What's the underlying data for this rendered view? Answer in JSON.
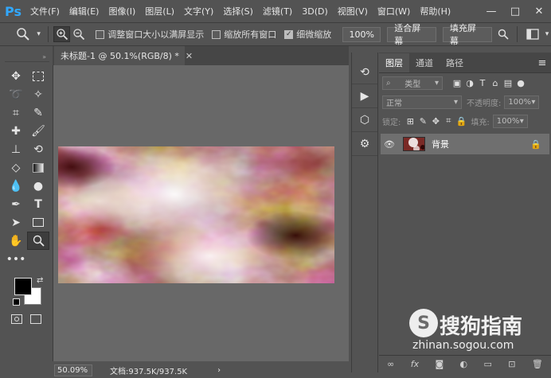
{
  "app": {
    "logo": "Ps"
  },
  "menu": [
    "文件(F)",
    "编辑(E)",
    "图像(I)",
    "图层(L)",
    "文字(Y)",
    "选择(S)",
    "滤镜(T)",
    "3D(D)",
    "视图(V)",
    "窗口(W)",
    "帮助(H)"
  ],
  "window_controls": {
    "minimize": "—",
    "maximize": "□",
    "close": "✕"
  },
  "options": {
    "resize_windows": "调整窗口大小以满屏显示",
    "zoom_all": "缩放所有窗口",
    "scrubby_zoom": "细微缩放",
    "zoom_100": "100%",
    "fit_screen": "适合屏幕",
    "fill_screen": "填充屏幕"
  },
  "document": {
    "tab_title": "未标题-1 @ 50.1%(RGB/8) *"
  },
  "status": {
    "zoom": "50.09%",
    "doc_info": "文档:937.5K/937.5K",
    "arrow": "›"
  },
  "layers_panel": {
    "tabs": [
      "图层",
      "通道",
      "路径"
    ],
    "filter_kind": "类型",
    "blend_mode": "正常",
    "opacity_label": "不透明度:",
    "opacity_value": "100%",
    "lock_label": "锁定:",
    "fill_label": "填充:",
    "fill_value": "100%",
    "layers": [
      {
        "name": "背景",
        "visible": true,
        "locked": true
      }
    ],
    "footer_icons": [
      "link-icon",
      "fx-icon",
      "mask-icon",
      "adjustment-icon",
      "folder-icon",
      "new-layer-icon",
      "trash-icon"
    ],
    "footer_fx": "fx"
  },
  "watermark": {
    "logo_char": "S",
    "title": "搜狗指南",
    "url": "zhinan.sogou.com"
  }
}
